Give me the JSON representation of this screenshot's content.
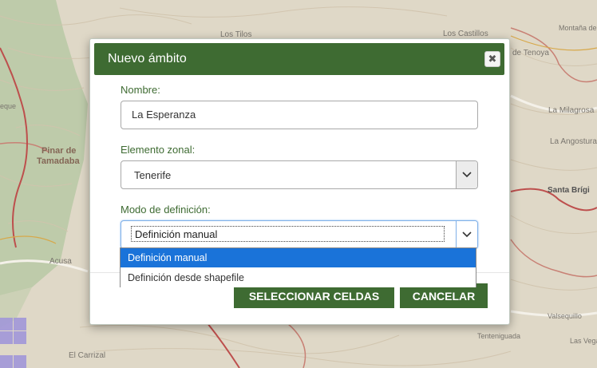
{
  "map": {
    "labels": [
      "Los Tilos",
      "Los Castillos",
      "Montaña de Ho",
      "de Tenoya",
      "eque",
      "Pinar de",
      "Tamadaba",
      "La Milagrosa",
      "La Angostura",
      "Santa Brígi",
      "Acusa",
      "El Carrizal",
      "Tenteniguada",
      "Valsequillo",
      "Las Vegas"
    ]
  },
  "dialog": {
    "title": "Nuevo ámbito",
    "close_symbol": "✖",
    "nombre_label": "Nombre:",
    "nombre_value": "La Esperanza",
    "elemento_label": "Elemento zonal:",
    "elemento_value": "Tenerife",
    "modo_label": "Modo de definición:",
    "modo_value": "Definición manual",
    "select_button": "SELECCIONAR CELDAS",
    "cancel_button": "CANCELAR"
  },
  "dropdown": {
    "options": [
      "Definición manual",
      "Definición desde shapefile"
    ]
  },
  "colors": {
    "header": "#3e6b32",
    "label": "#3e6b32",
    "option_selected": "#1a73d9"
  }
}
